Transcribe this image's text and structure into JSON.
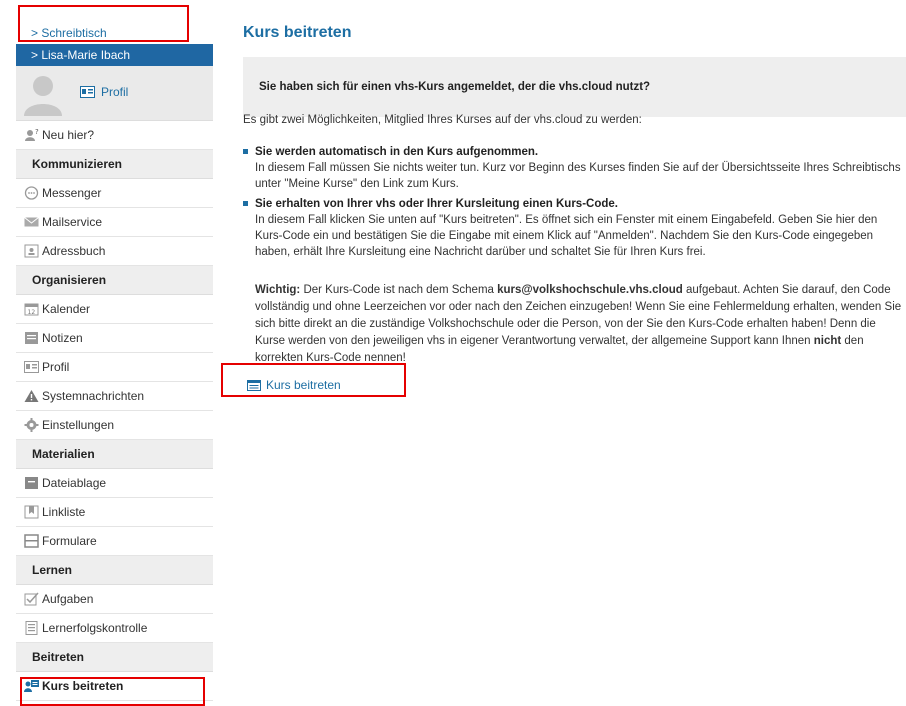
{
  "sidebar": {
    "desk_link": "> Schreibtisch",
    "user_name": "> Lisa-Marie Ibach",
    "profile_link": "Profil",
    "new_here": "Neu hier?",
    "sections": {
      "kommunizieren": "Kommunizieren",
      "organisieren": "Organisieren",
      "materialien": "Materialien",
      "lernen": "Lernen",
      "beitreten": "Beitreten"
    },
    "items": {
      "messenger": "Messenger",
      "mailservice": "Mailservice",
      "adressbuch": "Adressbuch",
      "kalender": "Kalender",
      "notizen": "Notizen",
      "profil": "Profil",
      "systemnachrichten": "Systemnachrichten",
      "einstellungen": "Einstellungen",
      "dateiablage": "Dateiablage",
      "linkliste": "Linkliste",
      "formulare": "Formulare",
      "aufgaben": "Aufgaben",
      "lernerfolgskontrolle": "Lernerfolgskontrolle",
      "kurs_beitreten": "Kurs beitreten"
    }
  },
  "main": {
    "title": "Kurs beitreten",
    "notice": "Sie haben sich für einen vhs-Kurs angemeldet, der die vhs.cloud nutzt?",
    "intro": "Es gibt zwei Möglichkeiten, Mitglied Ihres Kurses auf der vhs.cloud zu werden:",
    "option1_head": "Sie werden automatisch in den Kurs aufgenommen.",
    "option1_body": "In diesem Fall müssen Sie nichts weiter tun. Kurz vor Beginn des Kurses finden Sie auf der Übersichtsseite Ihres Schreibtischs unter \"Meine Kurse\" den Link zum Kurs.",
    "option2_head": "Sie erhalten von Ihrer vhs oder Ihrer Kursleitung einen Kurs-Code.",
    "option2_body": "In diesem Fall klicken Sie unten auf \"Kurs beitreten\". Es öffnet sich ein Fenster mit einem Eingabefeld. Geben Sie hier den Kurs-Code ein und bestätigen Sie die Eingabe mit einem Klick auf \"Anmelden\". Nachdem Sie den Kurs-Code eingegeben haben, erhält Ihre Kursleitung eine Nachricht darüber und schaltet Sie für Ihren Kurs frei.",
    "warn_label": "Wichtig:",
    "warn_1": " Der Kurs-Code ist nach dem Schema ",
    "warn_code": "kurs@volkshochschule.vhs.cloud",
    "warn_2": " aufgebaut. Achten Sie darauf, den Code vollständig und ohne Leerzeichen vor oder nach den Zeichen einzugeben! Wenn Sie eine Fehlermeldung erhalten, wenden Sie sich bitte direkt an die zuständige Volkshochschule oder die Person, von der Sie den Kurs-Code erhalten haben! Denn die Kurse werden von den jeweiligen vhs in eigener Verantwortung verwaltet, der allgemeine Support kann Ihnen ",
    "warn_not": "nicht",
    "warn_3": " den korrekten Kurs-Code nennen!",
    "join_link": "Kurs beitreten"
  },
  "colors": {
    "accent": "#1d6ea3",
    "user_bar": "#1f67a3",
    "highlight": "#e50000"
  }
}
